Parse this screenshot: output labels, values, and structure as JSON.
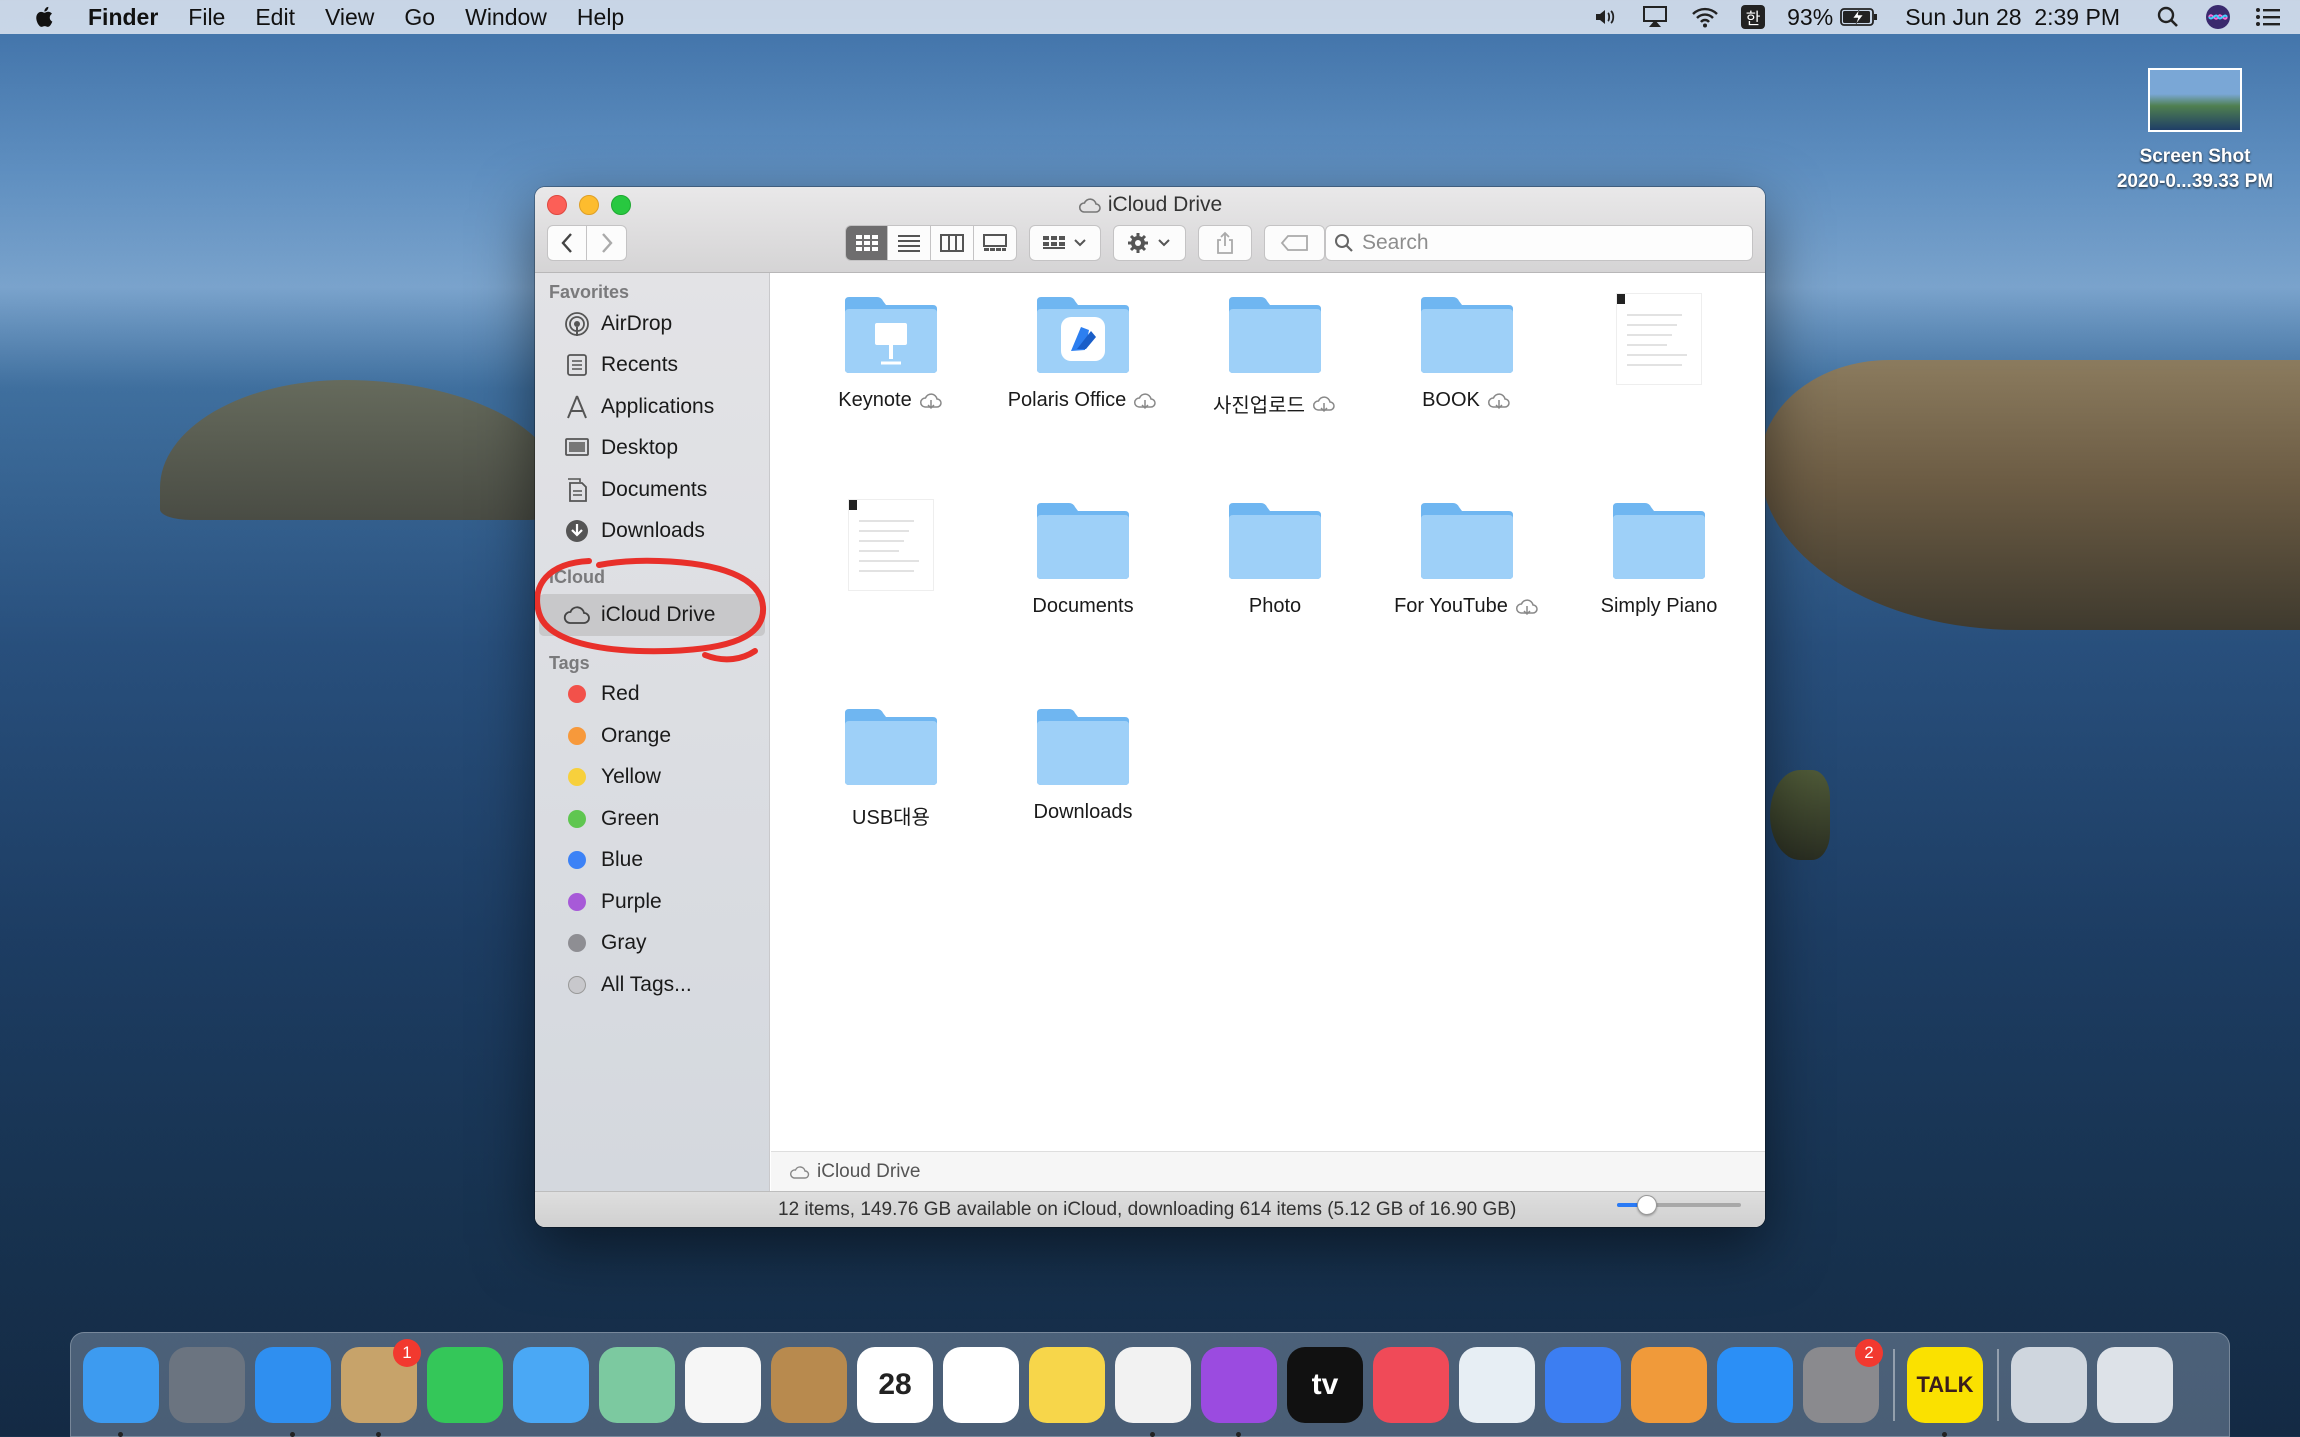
{
  "menubar": {
    "app_name": "Finder",
    "menus": [
      "File",
      "Edit",
      "View",
      "Go",
      "Window",
      "Help"
    ],
    "input_method": "한",
    "battery": "93%",
    "datetime": "Sun Jun 28  2:39 PM"
  },
  "window": {
    "title": "iCloud Drive",
    "search_placeholder": "Search",
    "sidebar": {
      "favorites_heading": "Favorites",
      "favorites": [
        {
          "label": "AirDrop",
          "icon": "airdrop-icon"
        },
        {
          "label": "Recents",
          "icon": "recents-icon"
        },
        {
          "label": "Applications",
          "icon": "applications-icon"
        },
        {
          "label": "Desktop",
          "icon": "desktop-icon"
        },
        {
          "label": "Documents",
          "icon": "documents-icon"
        },
        {
          "label": "Downloads",
          "icon": "downloads-icon"
        }
      ],
      "icloud_heading": "iCloud",
      "icloud_items": [
        {
          "label": "iCloud Drive",
          "icon": "cloud-icon",
          "selected": true
        }
      ],
      "tags_heading": "Tags",
      "tags": [
        {
          "label": "Red",
          "color": "#f2514a"
        },
        {
          "label": "Orange",
          "color": "#f7993b"
        },
        {
          "label": "Yellow",
          "color": "#f7d03c"
        },
        {
          "label": "Green",
          "color": "#5fc650"
        },
        {
          "label": "Blue",
          "color": "#3c82f6"
        },
        {
          "label": "Purple",
          "color": "#a75ad8"
        },
        {
          "label": "Gray",
          "color": "#8e8e93"
        },
        {
          "label": "All Tags...",
          "color": "#c8c8cc"
        }
      ]
    },
    "files": [
      {
        "label": "Keynote",
        "kind": "keynote-folder",
        "cloud": true
      },
      {
        "label": "Polaris Office",
        "kind": "polaris-folder",
        "cloud": true
      },
      {
        "label": "사진업로드",
        "kind": "folder",
        "cloud": true
      },
      {
        "label": "BOOK",
        "kind": "folder",
        "cloud": true
      },
      {
        "label": "",
        "kind": "document",
        "cloud": false
      },
      {
        "label": "",
        "kind": "document",
        "cloud": false
      },
      {
        "label": "Documents",
        "kind": "folder",
        "cloud": false
      },
      {
        "label": "Photo",
        "kind": "folder",
        "cloud": false
      },
      {
        "label": "For YouTube",
        "kind": "folder",
        "cloud": true
      },
      {
        "label": "Simply Piano",
        "kind": "folder",
        "cloud": false
      },
      {
        "label": "USB대용",
        "kind": "folder",
        "cloud": false
      },
      {
        "label": "Downloads",
        "kind": "folder",
        "cloud": false
      }
    ],
    "path": "iCloud Drive",
    "status": "12 items, 149.76 GB available on iCloud, downloading 614 items (5.12 GB of 16.90 GB)"
  },
  "desktop_file": {
    "line1": "Screen Shot",
    "line2": "2020-0...39.33 PM"
  },
  "dock": {
    "apps": [
      {
        "name": "finder-app",
        "bg": "#3d9bf0",
        "running": true
      },
      {
        "name": "launchpad-app",
        "bg": "#6b7480"
      },
      {
        "name": "safari-app",
        "bg": "#2f8ff0",
        "running": true
      },
      {
        "name": "mail-stamp-app",
        "bg": "#c7a36a",
        "badge": "1",
        "running": true
      },
      {
        "name": "facetime-app",
        "bg": "#34c759"
      },
      {
        "name": "messages-app",
        "bg": "#4aa8f5"
      },
      {
        "name": "maps-app",
        "bg": "#7cc9a0"
      },
      {
        "name": "photos-app",
        "bg": "#f6f6f6"
      },
      {
        "name": "contacts-app",
        "bg": "#b88a4e"
      },
      {
        "name": "calendar-app",
        "bg": "#ffffff",
        "text": "28"
      },
      {
        "name": "reminders-app",
        "bg": "#ffffff"
      },
      {
        "name": "notes-app",
        "bg": "#f7d64a"
      },
      {
        "name": "music-app",
        "bg": "#f2f2f2",
        "running": true
      },
      {
        "name": "podcasts-app",
        "bg": "#9b4be0",
        "running": true
      },
      {
        "name": "tv-app",
        "bg": "#111111",
        "text": "tv"
      },
      {
        "name": "news-app",
        "bg": "#f04a58"
      },
      {
        "name": "numbers-app",
        "bg": "#e7eef4"
      },
      {
        "name": "keynote-app",
        "bg": "#3c7ef2"
      },
      {
        "name": "pages-app",
        "bg": "#f09a3a"
      },
      {
        "name": "app-store-app",
        "bg": "#2b8ff6"
      },
      {
        "name": "system-preferences-app",
        "bg": "#8a8a8e",
        "badge": "2"
      },
      {
        "name": "kakaotalk-app",
        "bg": "#fae100",
        "text": "TALK",
        "running": true
      },
      {
        "name": "downloads-stack",
        "bg": "#cfd6de"
      },
      {
        "name": "trash-app",
        "bg": "#dde2e8"
      }
    ]
  }
}
